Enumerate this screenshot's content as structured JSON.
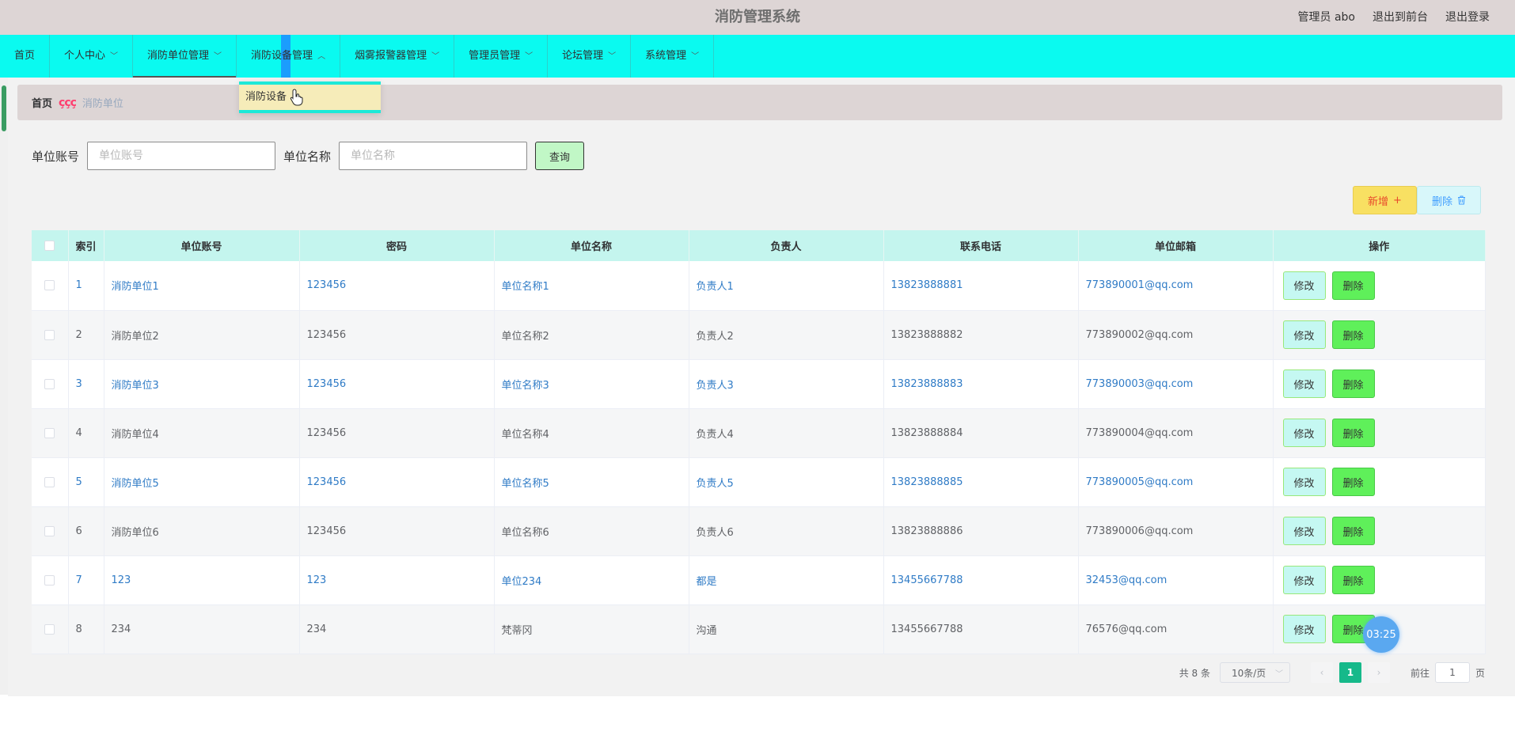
{
  "header": {
    "title": "消防管理系统",
    "user_label": "管理员 abo",
    "back_label": "退出到前台",
    "logout_label": "退出登录"
  },
  "nav": {
    "home": "首页",
    "items": [
      {
        "label": "个人中心"
      },
      {
        "label": "消防单位管理"
      },
      {
        "label": "消防设备管理"
      },
      {
        "label": "烟雾报警器管理"
      },
      {
        "label": "管理员管理"
      },
      {
        "label": "论坛管理"
      },
      {
        "label": "系统管理"
      }
    ],
    "dropdown_item": "消防设备"
  },
  "breadcrumb": {
    "home": "首页",
    "separator": "ççç",
    "current": "消防单位"
  },
  "search": {
    "account_label": "单位账号",
    "account_placeholder": "单位账号",
    "name_label": "单位名称",
    "name_placeholder": "单位名称",
    "query_label": "查询"
  },
  "actions": {
    "add_label": "新增",
    "delete_label": "删除"
  },
  "table": {
    "headers": [
      "索引",
      "单位账号",
      "密码",
      "单位名称",
      "负责人",
      "联系电话",
      "单位邮箱",
      "操作"
    ],
    "edit_label": "修改",
    "delete_label": "删除",
    "rows": [
      [
        "1",
        "消防单位1",
        "123456",
        "单位名称1",
        "负责人1",
        "13823888881",
        "773890001@qq.com"
      ],
      [
        "2",
        "消防单位2",
        "123456",
        "单位名称2",
        "负责人2",
        "13823888882",
        "773890002@qq.com"
      ],
      [
        "3",
        "消防单位3",
        "123456",
        "单位名称3",
        "负责人3",
        "13823888883",
        "773890003@qq.com"
      ],
      [
        "4",
        "消防单位4",
        "123456",
        "单位名称4",
        "负责人4",
        "13823888884",
        "773890004@qq.com"
      ],
      [
        "5",
        "消防单位5",
        "123456",
        "单位名称5",
        "负责人5",
        "13823888885",
        "773890005@qq.com"
      ],
      [
        "6",
        "消防单位6",
        "123456",
        "单位名称6",
        "负责人6",
        "13823888886",
        "773890006@qq.com"
      ],
      [
        "7",
        "123",
        "123",
        "单位234",
        "都是",
        "13455667788",
        "32453@qq.com"
      ],
      [
        "8",
        "234",
        "234",
        "梵蒂冈",
        "沟通",
        "13455667788",
        "76576@qq.com"
      ]
    ]
  },
  "timer": "03:25",
  "pagination": {
    "total": "共 8 条",
    "page_size": "10条/页",
    "current_page": "1",
    "goto_prefix": "前往",
    "goto_value": "1",
    "goto_suffix": "页"
  }
}
